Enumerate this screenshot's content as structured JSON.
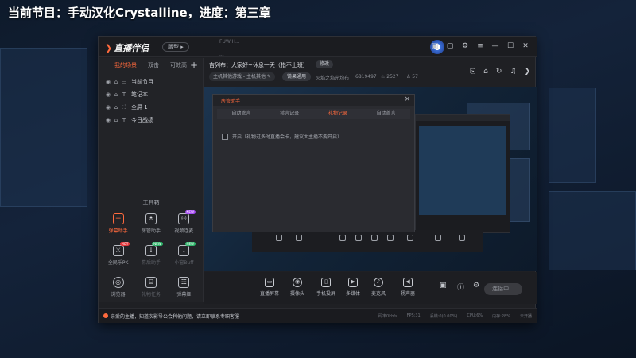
{
  "overlay_title": "当前节目：手动汉化Crystalline，进度：第三章",
  "app": {
    "logo": "直播伴侣",
    "version_btn": "版型 ▸",
    "title_info": [
      "FUWIH...",
      "...",
      "..."
    ],
    "window_icons": [
      "shirt-icon",
      "chat-icon",
      "settings-icon",
      "menu-icon",
      "minimize-icon",
      "maximize-icon",
      "close-icon"
    ]
  },
  "sidebar": {
    "tabs": [
      "我的场景",
      "双击",
      "可效高"
    ],
    "add": "+",
    "scenes": [
      {
        "label": "当前节目"
      },
      {
        "label": "笔记本"
      },
      {
        "label": "全屏 1"
      },
      {
        "label": "今日战绩"
      }
    ],
    "tools_title": "工具箱",
    "tools": [
      {
        "label": "弹幕助手",
        "icon": "danmaku-icon",
        "active": true,
        "badge": ""
      },
      {
        "label": "房管助手",
        "icon": "shield-icon",
        "active": false,
        "badge": ""
      },
      {
        "label": "视频连麦",
        "icon": "video-link-icon",
        "active": false,
        "badge": "NEW"
      },
      {
        "label": "全民乐PK",
        "icon": "pk-icon",
        "active": false,
        "badge": "HOT"
      },
      {
        "label": "幕后助手",
        "icon": "download-icon",
        "active": false,
        "badge": "NEW",
        "dim": true
      },
      {
        "label": "小窗Buff",
        "icon": "download-icon",
        "active": false,
        "badge": "NEW",
        "dim": true
      },
      {
        "label": "浏览器",
        "icon": "browser-icon",
        "active": false,
        "badge": ""
      },
      {
        "label": "礼物任务",
        "icon": "gift-icon",
        "active": false,
        "badge": "",
        "dim": true
      },
      {
        "label": "弹幕姬",
        "icon": "danmaku-robot-icon",
        "active": false,
        "badge": ""
      }
    ]
  },
  "header": {
    "room_title": "吉列布：大家好~休息一天（指不上班）",
    "edit_btn": "修改",
    "category": "主机其他游戏 - 主机其他 ✎",
    "cover_btn": "镜果通用",
    "fans_label": "火焰之焰光均布",
    "room_id": "6819497",
    "popularity": "2527",
    "followers": "57"
  },
  "dialog": {
    "title": "房管助手",
    "close": "×",
    "tabs": [
      "自动管言",
      "禁言记录",
      "礼物记录",
      "自动首言"
    ],
    "active_tab": 2,
    "checkbox_text": "开启（礼物过多时直播会卡，建议大主播不要开启）"
  },
  "toolbar": {
    "buttons": [
      {
        "label": "直播屏幕",
        "icon": "screen-icon"
      },
      {
        "label": "摄像头",
        "icon": "camera-icon"
      },
      {
        "label": "手机投屏",
        "icon": "phone-cast-icon"
      },
      {
        "label": "多媒体",
        "icon": "media-icon"
      },
      {
        "label": "麦克风",
        "icon": "mic-icon"
      },
      {
        "label": "扬声器",
        "icon": "speaker-icon"
      }
    ],
    "live_btn": "连接中..."
  },
  "status": {
    "notice": "亲爱的主播，知道次影导公会利他问题，请立即联系专职客服",
    "stats": [
      "码率0kb/s",
      "FPS:31",
      "丢帧:0(0.00%)",
      "CPU:6%",
      "内存:28%",
      "未开播"
    ]
  }
}
